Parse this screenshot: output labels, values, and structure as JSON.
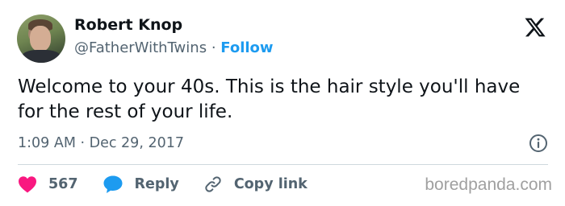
{
  "author": {
    "name": "Robert Knop",
    "handle": "@FatherWithTwins",
    "separator": "·",
    "follow_label": "Follow"
  },
  "tweet": {
    "text": "Welcome to your 40s. This is the hair style you'll have for the rest of your life.",
    "timestamp": "1:09 AM · Dec 29, 2017"
  },
  "actions": {
    "likes_count": "567",
    "reply_label": "Reply",
    "copy_link_label": "Copy link"
  },
  "watermark": "boredpanda.com",
  "icons": {
    "brand": "x-logo-icon",
    "info": "info-icon",
    "like": "heart-icon",
    "reply": "speech-bubble-icon",
    "copy": "link-icon"
  },
  "colors": {
    "text": "#0f1419",
    "muted": "#536471",
    "follow": "#1d9bf0",
    "heart": "#f91880",
    "reply": "#1d9bf0",
    "divider": "#cfd9de"
  }
}
